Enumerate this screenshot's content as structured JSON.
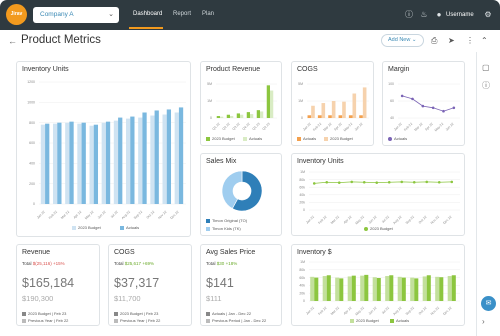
{
  "nav": {
    "logo": "Jirav",
    "company": "Company A",
    "tabs": [
      "Dashboard",
      "Report",
      "Plan"
    ],
    "username": "Username"
  },
  "header": {
    "title": "Product Metrics",
    "add_new": "Add New"
  },
  "colors": {
    "nav_bg": "#2f3a40",
    "accent": "#f29a1e",
    "blue": "#7ab8df",
    "green": "#8cc63f",
    "orange": "#f3a04d",
    "purple": "#7a63b5"
  },
  "icons": {
    "help": "help-icon",
    "bell": "bell-icon",
    "avatar": "user-icon",
    "settings": "gear-icon",
    "print": "print-icon",
    "share": "share-icon",
    "more": "more-icon",
    "collapse": "chevron-up-icon",
    "back": "arrow-left-icon"
  },
  "inventory_units": {
    "title": "Inventory Units",
    "legend": [
      "2023 Budget",
      "Actuals"
    ]
  },
  "product_revenue": {
    "title": "Product Revenue",
    "legend": [
      "2023 Budget",
      "Actuals"
    ]
  },
  "cogs": {
    "title": "COGS",
    "legend": [
      "Actuals",
      "2023 Budget"
    ]
  },
  "margin": {
    "title": "Margin",
    "legend": [
      "Actuals"
    ]
  },
  "sales_mix": {
    "title": "Sales Mix",
    "legend": [
      "Timon Original (TO)",
      "Timon Kids (TK)"
    ]
  },
  "inventory_units_line": {
    "title": "Inventory Units",
    "legend": [
      "2023 Budget"
    ]
  },
  "inventory_dollar": {
    "title": "Inventory $",
    "legend": [
      "2023 Budget",
      "Actuals"
    ]
  },
  "kpis": [
    {
      "title": "Revenue",
      "total_label": "Total",
      "total_value": "$(25,116)",
      "change": "+15%",
      "value": "$165,184",
      "previous": "$190,300",
      "legend": [
        "2023 Budget | Feb 23",
        "Previous Year | Feb 22"
      ]
    },
    {
      "title": "COGS",
      "total_label": "Total",
      "total_value": "$25,617",
      "change": "+69%",
      "value": "$37,317",
      "previous": "$11,700",
      "legend": [
        "2023 Budget | Feb 23",
        "Previous Year | Feb 22"
      ]
    },
    {
      "title": "Avg Sales Price",
      "total_label": "Total",
      "total_value": "$30",
      "change": "+18%",
      "value": "$141",
      "previous": "$111",
      "legend": [
        "Actuals | Jan - Dec 22",
        "Previous Period | Jan - Dec 22"
      ]
    }
  ],
  "chart_data": [
    {
      "type": "bar",
      "title": "Inventory Units",
      "categories": [
        "Jan 22",
        "Feb 22",
        "Mar 22",
        "Apr 22",
        "May 22",
        "Jun 22",
        "Jul 22",
        "Aug 22",
        "Sep 22",
        "Oct 22",
        "Nov 22",
        "Dec 22"
      ],
      "ylim": [
        0,
        1200
      ],
      "yticks": [
        "1200",
        "1000",
        "800",
        "600",
        "400",
        "200",
        "0"
      ],
      "series": [
        {
          "name": "2023 Budget",
          "values": [
            780,
            790,
            800,
            790,
            770,
            800,
            820,
            840,
            850,
            870,
            880,
            900
          ]
        },
        {
          "name": "Actuals",
          "values": [
            790,
            800,
            810,
            800,
            780,
            810,
            850,
            860,
            900,
            920,
            930,
            950
          ]
        }
      ]
    },
    {
      "type": "bar",
      "title": "Product Revenue",
      "categories": [
        "Q1 22",
        "Q2 22",
        "Q3 22",
        "Q4 22",
        "Q1 23",
        "Q2 23"
      ],
      "yticks": [
        "5M",
        "1M",
        "0"
      ],
      "series": [
        {
          "name": "2023 Budget",
          "values": [
            0.3,
            0.5,
            0.7,
            0.9,
            1.2,
            5.0
          ]
        },
        {
          "name": "Actuals",
          "values": [
            0.2,
            0.3,
            0.5,
            0.6,
            1.0,
            4.2
          ]
        }
      ]
    },
    {
      "type": "bar",
      "title": "COGS",
      "categories": [
        "Jan 22",
        "Feb 22",
        "Mar 22",
        "Apr 22",
        "May 22",
        "Jun 22"
      ],
      "yticks": [
        "5M",
        "1M",
        "0"
      ],
      "series": [
        {
          "name": "Actuals",
          "values": [
            0.4,
            0.4,
            0.4,
            0.4,
            0.4,
            0.4
          ]
        },
        {
          "name": "2023 Budget",
          "values": [
            1.8,
            2.2,
            2.5,
            2.4,
            3.6,
            4.5
          ]
        }
      ]
    },
    {
      "type": "line",
      "title": "Margin",
      "categories": [
        "Jan 22",
        "Feb 22",
        "Mar 22",
        "Apr 22",
        "May 22",
        "Jun 22"
      ],
      "yticks": [
        "100",
        "60",
        "40"
      ],
      "series": [
        {
          "name": "Actuals",
          "values": [
            72,
            65,
            48,
            44,
            36,
            44
          ]
        }
      ]
    },
    {
      "type": "pie",
      "title": "Sales Mix",
      "series": [
        {
          "name": "Timon Original (TO)",
          "values": [
            58
          ]
        },
        {
          "name": "Timon Kids (TK)",
          "values": [
            42
          ]
        }
      ]
    },
    {
      "type": "line",
      "title": "Inventory Units",
      "categories": [
        "Jan 22",
        "Feb 22",
        "Mar 22",
        "Apr 22",
        "May 22",
        "Jun 22",
        "Jul 22",
        "Aug 22",
        "Sep 22",
        "Oct 22",
        "Nov 22",
        "Dec 22"
      ],
      "yticks": [
        "1M",
        "80k",
        "60k",
        "40k",
        "20k",
        "0"
      ],
      "series": [
        {
          "name": "2023 Budget",
          "values": [
            70,
            73,
            72,
            74,
            73,
            72,
            73,
            74,
            73,
            74,
            73,
            74
          ]
        }
      ]
    },
    {
      "type": "bar",
      "title": "Inventory $",
      "categories": [
        "Jan 22",
        "Feb 22",
        "Mar 22",
        "Apr 22",
        "May 22",
        "Jun 22",
        "Jul 22",
        "Aug 22",
        "Sep 22",
        "Oct 22",
        "Nov 22",
        "Dec 22"
      ],
      "yticks": [
        "1M",
        "80k",
        "60k",
        "40k",
        "20k",
        "0"
      ],
      "series": [
        {
          "name": "2023 Budget",
          "values": [
            62,
            64,
            60,
            63,
            65,
            61,
            64,
            62,
            60,
            63,
            62,
            64
          ]
        },
        {
          "name": "Actuals",
          "values": [
            60,
            66,
            58,
            65,
            67,
            59,
            66,
            60,
            58,
            66,
            61,
            66
          ]
        }
      ]
    }
  ]
}
